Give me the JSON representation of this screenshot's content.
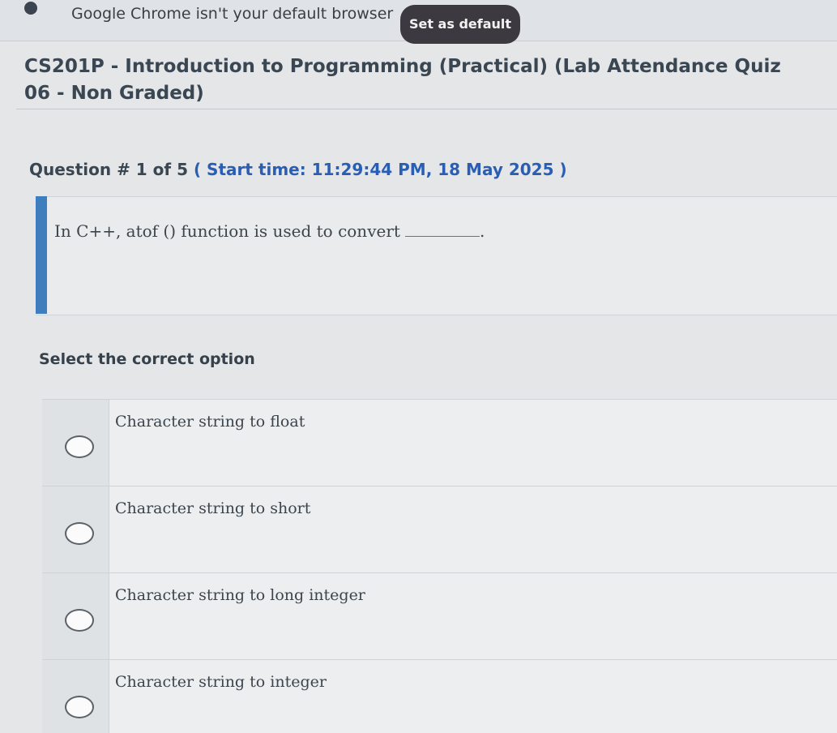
{
  "infobar": {
    "message": "Google Chrome isn't your default browser",
    "button_label": "Set as default",
    "icon": "info-icon"
  },
  "page": {
    "title": "CS201P - Introduction to Programming (Practical) (Lab Attendance Quiz 06 - Non Graded)"
  },
  "question": {
    "heading_prefix": "Question # 1 of 5 ",
    "start_time": "( Start time: 11:29:44 PM, 18 May 2025 )",
    "text": "In C++, atof () function is used to convert",
    "blank_suffix": "."
  },
  "options": {
    "label": "Select the correct option",
    "items": [
      {
        "text": "Character string to float"
      },
      {
        "text": "Character string to short"
      },
      {
        "text": "Character string to long integer"
      },
      {
        "text": "Character string to integer"
      }
    ]
  },
  "colors": {
    "accent": "#3e7dbe",
    "start_time": "#2a5eb5",
    "button_bg": "#3c3941"
  }
}
